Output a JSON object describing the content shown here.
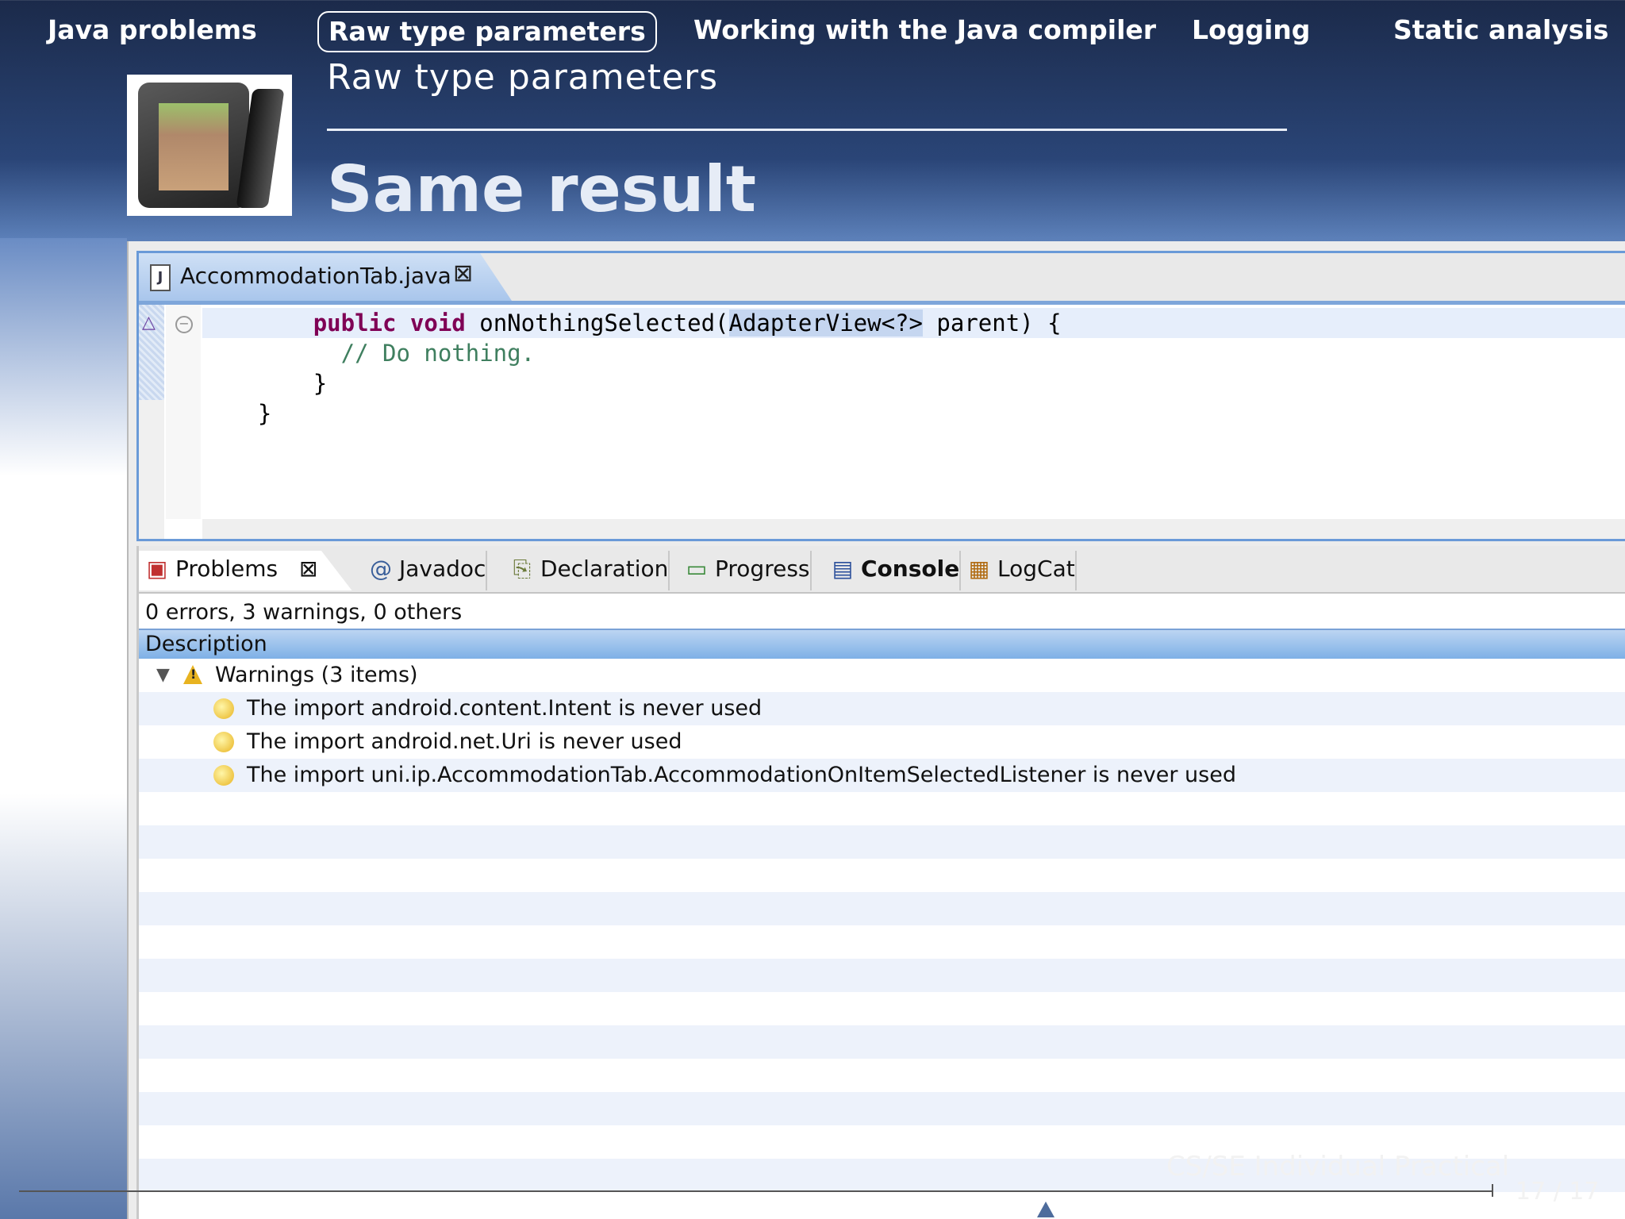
{
  "nav": {
    "items": [
      {
        "label": "Java problems",
        "active": false
      },
      {
        "label": "Raw type parameters",
        "active": true
      },
      {
        "label": "Working with the Java compiler",
        "active": false
      },
      {
        "label": "Logging",
        "active": false
      },
      {
        "label": "Static analysis",
        "active": false
      }
    ]
  },
  "slide": {
    "section": "Raw type parameters",
    "title": "Same result"
  },
  "editor": {
    "tab_label": "AccommodationTab.java",
    "code": {
      "line1_kw1": "public",
      "line1_kw2": "void",
      "line1_method": "onNothingSelected(",
      "line1_highlight": "AdapterView<?>",
      "line1_rest": " parent) {",
      "line2": "// Do nothing.",
      "line3": "}",
      "line4": "}"
    }
  },
  "problems_view": {
    "tabs": [
      {
        "label": "Problems",
        "icon": "problems-icon"
      },
      {
        "label": "Javadoc",
        "icon": "at-icon"
      },
      {
        "label": "Declaration",
        "icon": "declaration-icon"
      },
      {
        "label": "Progress",
        "icon": "progress-icon"
      },
      {
        "label": "Console",
        "icon": "console-icon"
      },
      {
        "label": "LogCat",
        "icon": "logcat-icon"
      }
    ],
    "summary": "0 errors, 3 warnings, 0 others",
    "column_header": "Description",
    "group_label": "Warnings (3 items)",
    "warnings": [
      "The import android.content.Intent is never used",
      "The import android.net.Uri is never used",
      "The import uni.ip.AccommodationTab.AccommodationOnItemSelectedListener is never used"
    ]
  },
  "footer": {
    "course": "CS/SE Individual Practical",
    "page": "17 / 17"
  },
  "colors": {
    "keyword": "#7f0055",
    "comment": "#3f7f5f",
    "warning": "#e8b320",
    "header_bg": "#2a4577"
  }
}
